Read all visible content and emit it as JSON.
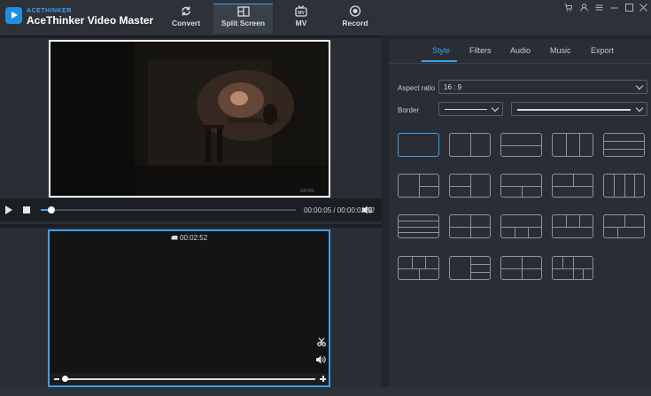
{
  "app": {
    "brand_small": "ACETHINKER",
    "brand_name": "AceThinker Video Master"
  },
  "toolbar": {
    "convert": "Convert",
    "split_screen": "Split Screen",
    "mv": "MV",
    "record": "Record"
  },
  "player": {
    "time": "00:00:05 / 00:00:02:52",
    "progress": 0.04,
    "watermark": "BATAR"
  },
  "slot": {
    "duration": "00:02:52"
  },
  "tabs": {
    "style": "Style",
    "filters": "Filters",
    "audio": "Audio",
    "music": "Music",
    "export": "Export"
  },
  "style": {
    "aspect_label": "Aspect ratio",
    "aspect_value": "16 : 9",
    "border_label": "Border"
  },
  "colors": {
    "accent": "#3aa0ea"
  },
  "icons": [
    "convert-icon",
    "split-screen-icon",
    "mv-icon",
    "record-icon",
    "play-icon",
    "stop-icon",
    "volume-icon",
    "clock-icon",
    "scissors-icon",
    "minus-icon",
    "plus-icon",
    "cart-icon",
    "user-icon",
    "menu-icon",
    "minimize-icon",
    "maximize-icon",
    "close-icon"
  ]
}
